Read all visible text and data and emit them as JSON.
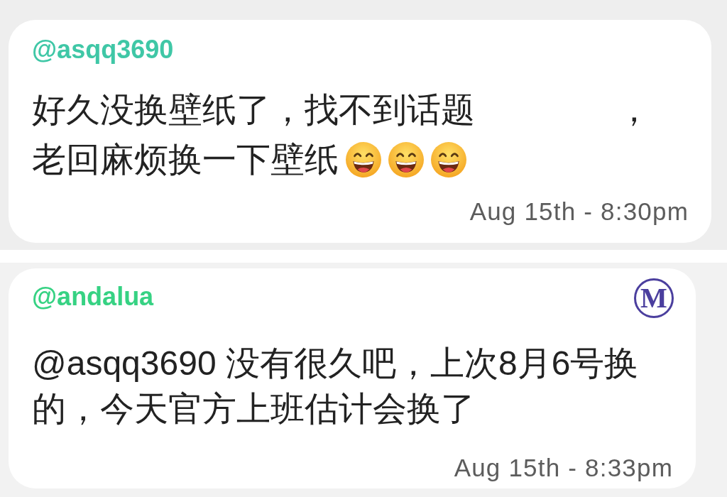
{
  "messages": [
    {
      "username": "@asqq3690",
      "color": "#3fc7a6",
      "lines": [
        [
          {
            "kind": "text",
            "text": "好久没换壁纸了，找不到话题"
          },
          {
            "kind": "gap"
          },
          {
            "kind": "text",
            "text": "，"
          }
        ],
        [
          {
            "kind": "text",
            "text": "老回麻烦换一下壁纸"
          },
          {
            "kind": "grin"
          },
          {
            "kind": "grin"
          },
          {
            "kind": "grin"
          }
        ]
      ],
      "time": "Aug 15th - 8:30pm"
    },
    {
      "username": "@andalua",
      "color": "#36d283",
      "badge": "M",
      "lines": [
        [
          {
            "kind": "text",
            "text": "@asqq3690 没有很久吧，上次8月6号换"
          }
        ],
        [
          {
            "kind": "text",
            "text": "的，今天官方上班估计会换了"
          }
        ]
      ],
      "time": "Aug 15th - 8:33pm"
    }
  ]
}
